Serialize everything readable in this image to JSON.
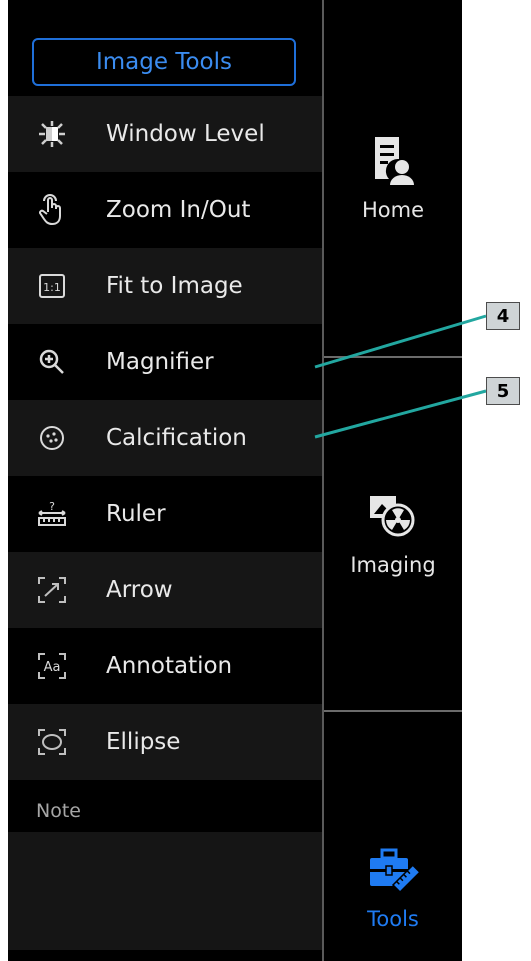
{
  "panel": {
    "header": "Image Tools",
    "tools": [
      {
        "label": "Window Level",
        "icon": "window-level-icon"
      },
      {
        "label": "Zoom In/Out",
        "icon": "hand-pointer-icon"
      },
      {
        "label": "Fit to Image",
        "icon": "fit-1-1-icon"
      },
      {
        "label": "Magnifier",
        "icon": "magnifier-plus-icon"
      },
      {
        "label": "Calcification",
        "icon": "calcification-icon"
      },
      {
        "label": "Ruler",
        "icon": "ruler-icon"
      },
      {
        "label": "Arrow",
        "icon": "arrow-icon"
      },
      {
        "label": "Annotation",
        "icon": "annotation-aa-icon"
      },
      {
        "label": "Ellipse",
        "icon": "ellipse-icon"
      }
    ],
    "note_label": "Note"
  },
  "nav": {
    "items": [
      {
        "label": "Home",
        "icon": "home-document-user-icon",
        "active": false
      },
      {
        "label": "Imaging",
        "icon": "imaging-radiation-icon",
        "active": false
      },
      {
        "label": "Tools",
        "icon": "toolbox-icon",
        "active": true
      }
    ]
  },
  "callouts": [
    "4",
    "5"
  ],
  "colors": {
    "accent": "#1f7bf2",
    "background": "#000000",
    "callout_line": "#22a7a0"
  }
}
